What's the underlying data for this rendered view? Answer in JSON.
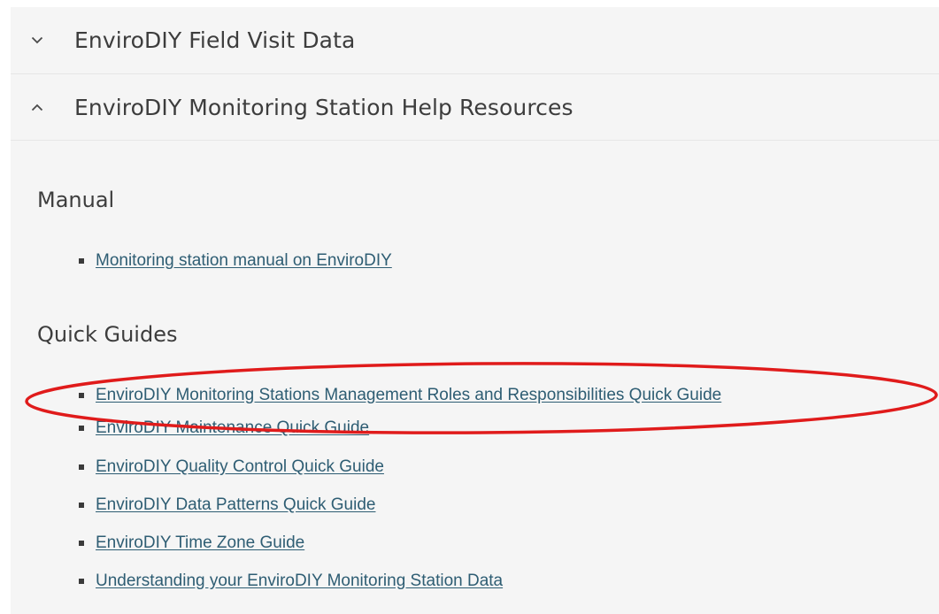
{
  "accordion": {
    "sections": [
      {
        "title": "EnviroDIY Field Visit Data",
        "state": "collapsed",
        "icon": "chevron-down-icon"
      },
      {
        "title": "EnviroDIY Monitoring Station Help Resources",
        "state": "expanded",
        "icon": "chevron-up-icon"
      }
    ]
  },
  "help_resources": {
    "manual": {
      "heading": "Manual",
      "links": [
        "Monitoring station manual on EnviroDIY"
      ]
    },
    "quick_guides": {
      "heading": "Quick Guides",
      "links": [
        "EnviroDIY Monitoring Stations Management Roles and Responsibilities Quick Guide",
        "EnviroDIY Maintenance Quick Guide",
        "EnviroDIY Quality Control Quick Guide",
        "EnviroDIY Data Patterns Quick Guide",
        "EnviroDIY Time Zone Guide",
        "Understanding your EnviroDIY Monitoring Station Data"
      ]
    }
  },
  "annotation": {
    "type": "ellipse",
    "color": "#e01b1b",
    "target": "EnviroDIY Monitoring Stations Management Roles and Responsibilities Quick Guide"
  },
  "colors": {
    "link": "#2e5d73",
    "panel_background": "#f5f5f5",
    "heading_text": "#3d3d3d"
  }
}
